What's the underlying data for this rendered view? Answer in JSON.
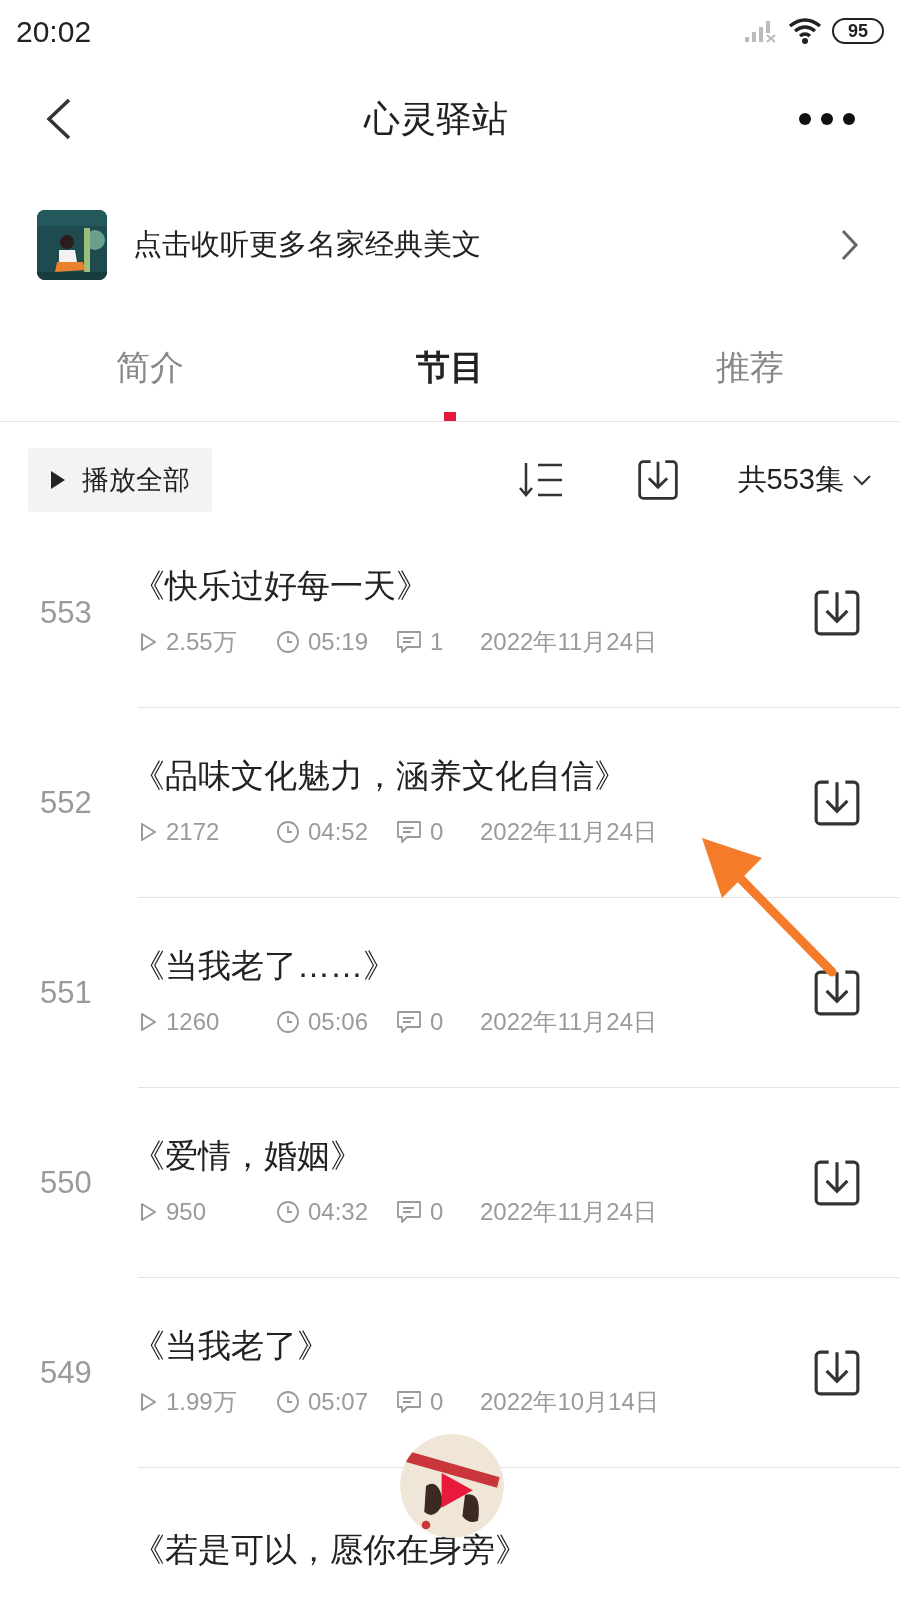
{
  "status_bar": {
    "time": "20:02",
    "battery": "95"
  },
  "header": {
    "title": "心灵驿站"
  },
  "banner": {
    "text": "点击收听更多名家经典美文"
  },
  "tabs": [
    {
      "label": "简介",
      "selected": false
    },
    {
      "label": "节目",
      "selected": true
    },
    {
      "label": "推荐",
      "selected": false
    }
  ],
  "toolbar": {
    "play_all": "播放全部",
    "count": "共553集"
  },
  "episodes": [
    {
      "number": "553",
      "title": "《快乐过好每一天》",
      "plays": "2.55万",
      "duration": "05:19",
      "comments": "1",
      "date": "2022年11月24日"
    },
    {
      "number": "552",
      "title": "《品味文化魅力，涵养文化自信》",
      "plays": "2172",
      "duration": "04:52",
      "comments": "0",
      "date": "2022年11月24日"
    },
    {
      "number": "551",
      "title": "《当我老了……》",
      "plays": "1260",
      "duration": "05:06",
      "comments": "0",
      "date": "2022年11月24日"
    },
    {
      "number": "550",
      "title": "《爱情，婚姻》",
      "plays": "950",
      "duration": "04:32",
      "comments": "0",
      "date": "2022年11月24日"
    },
    {
      "number": "549",
      "title": "《当我老了》",
      "plays": "1.99万",
      "duration": "05:07",
      "comments": "0",
      "date": "2022年10月14日"
    },
    {
      "title": "《若是可以，愿你在身旁》"
    }
  ]
}
